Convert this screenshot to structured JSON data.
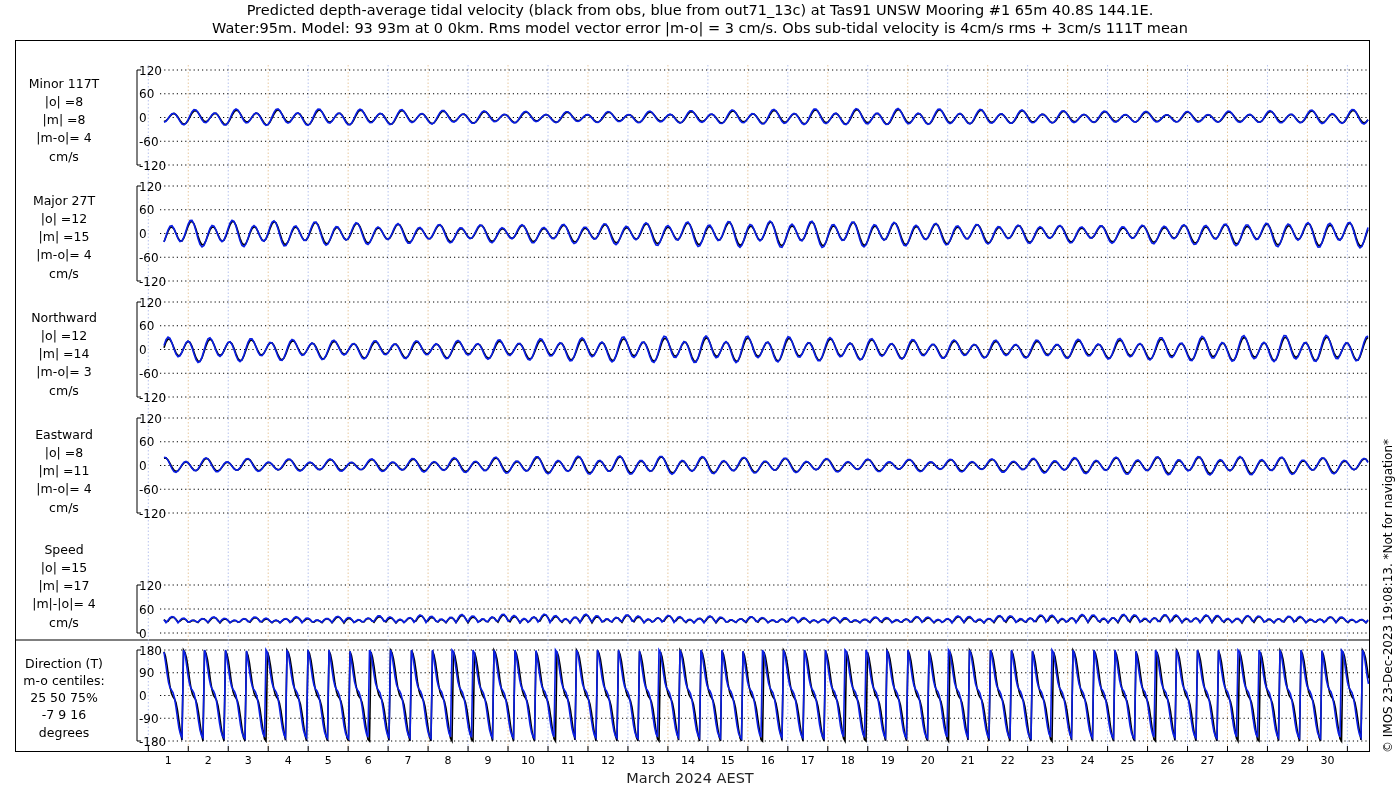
{
  "title_lines": [
    "Predicted depth-average tidal velocity (black from obs, blue from out71_13c) at Tas91 UNSW Mooring #1 65m 40.8S 144.1E.",
    "Water:95m. Model: 93 93m at 0 0km. Rms model vector error |m-o| = 3 cm/s. Obs sub-tidal velocity is 4cm/s rms + 3cm/s 111T mean"
  ],
  "panels": [
    {
      "kind": "signed",
      "label_lines": [
        "Minor 117T",
        "|o| =8",
        "|m| =8",
        "|m-o|= 4",
        "cm/s"
      ],
      "yticks": [
        "120",
        "60",
        "0",
        "-60",
        "-120"
      ]
    },
    {
      "kind": "signed",
      "label_lines": [
        "Major 27T",
        "|o| =12",
        "|m| =15",
        "|m-o|= 4",
        "cm/s"
      ],
      "yticks": [
        "120",
        "60",
        "0",
        "-60",
        "-120"
      ]
    },
    {
      "kind": "signed",
      "label_lines": [
        "Northward",
        "|o| =12",
        "|m| =14",
        "|m-o|= 3",
        "cm/s"
      ],
      "yticks": [
        "120",
        "60",
        "0",
        "-60",
        "-120"
      ]
    },
    {
      "kind": "signed",
      "label_lines": [
        "Eastward",
        "|o| =8",
        "|m| =11",
        "|m-o|= 4",
        "cm/s"
      ],
      "yticks": [
        "120",
        "60",
        "0",
        "-60",
        "-120"
      ]
    },
    {
      "kind": "speed",
      "label_lines": [
        "Speed",
        "|o| =15",
        "|m| =17",
        "|m|-|o|= 4",
        "cm/s"
      ],
      "yticks": [
        "120",
        "60",
        "0"
      ]
    },
    {
      "kind": "direction",
      "label_lines": [
        "Direction (T)",
        "m-o centiles:",
        "25  50  75%",
        "-7   9  16",
        "degrees"
      ],
      "yticks": [
        "180",
        "90",
        "0",
        "-90",
        "-180"
      ]
    }
  ],
  "x_axis": {
    "ticks": [
      "1",
      "2",
      "3",
      "4",
      "5",
      "6",
      "7",
      "8",
      "9",
      "10",
      "11",
      "12",
      "13",
      "14",
      "15",
      "16",
      "17",
      "18",
      "19",
      "20",
      "21",
      "22",
      "23",
      "24",
      "25",
      "26",
      "27",
      "28",
      "29",
      "30"
    ],
    "label": "March 2024 AEST"
  },
  "credit": "© IMOS 23-Dec-2023 19:08:13. *Not for navigation*"
}
